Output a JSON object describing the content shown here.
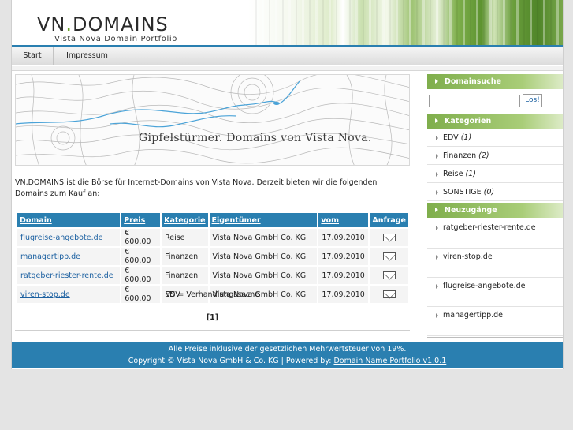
{
  "header": {
    "title_part1": "VN",
    "title_dot": ".",
    "title_part2": "DOMAINS",
    "subtitle": "Vista Nova Domain Portfolio"
  },
  "nav": {
    "items": [
      {
        "label": "Start"
      },
      {
        "label": "Impressum"
      }
    ]
  },
  "banner": {
    "text": "Gipfelstürmer. Domains von Vista Nova."
  },
  "intro": "VN.DOMAINS ist die Börse für Internet-Domains von Vista Nova. Derzeit bieten wir die folgenden Domains zum Kauf an:",
  "table": {
    "headers": {
      "domain": "Domain",
      "price": "Preis",
      "category": "Kategorie",
      "owner": "Eigentümer",
      "date": "vom",
      "request": "Anfrage"
    },
    "rows": [
      {
        "domain": "flugreise-angebote.de",
        "price": "€ 600.00",
        "category": "Reise",
        "owner": "Vista Nova GmbH Co. KG",
        "date": "17.09.2010"
      },
      {
        "domain": "managertipp.de",
        "price": "€ 600.00",
        "category": "Finanzen",
        "owner": "Vista Nova GmbH Co. KG",
        "date": "17.09.2010"
      },
      {
        "domain": "ratgeber-riester-rente.de",
        "price": "€ 600.00",
        "category": "Finanzen",
        "owner": "Vista Nova GmbH Co. KG",
        "date": "17.09.2010"
      },
      {
        "domain": "viren-stop.de",
        "price": "€ 600.00",
        "category": "EDV",
        "owner": "Vista Nova GmbH Co. KG",
        "date": "17.09.2010"
      }
    ]
  },
  "vs_note": "VS = Verhandlungssache",
  "pager": "[1]",
  "sidebar": {
    "search_title": "Domainsuche",
    "search_value": "",
    "search_button": "Los!",
    "categories_title": "Kategorien",
    "categories": [
      {
        "name": "EDV",
        "count": "(1)"
      },
      {
        "name": "Finanzen",
        "count": "(2)"
      },
      {
        "name": "Reise",
        "count": "(1)"
      },
      {
        "name": "SONSTIGE",
        "count": "(0)"
      }
    ],
    "new_title": "Neuzugänge",
    "new_items": [
      {
        "name": "ratgeber-riester-rente.de"
      },
      {
        "name": "viren-stop.de"
      },
      {
        "name": "flugreise-angebote.de"
      },
      {
        "name": "managertipp.de"
      }
    ]
  },
  "footer": {
    "line1": "Alle Preise inklusive der gesetzlichen Mehrwertsteuer von 19%.",
    "line2_prefix": "Copyright © Vista Nova GmbH & Co. KG | Powered by: ",
    "line2_link": "Domain Name Portfolio v1.0.1"
  },
  "colors": {
    "accent_blue": "#2a7fb0",
    "accent_green": "#7fae4c"
  }
}
